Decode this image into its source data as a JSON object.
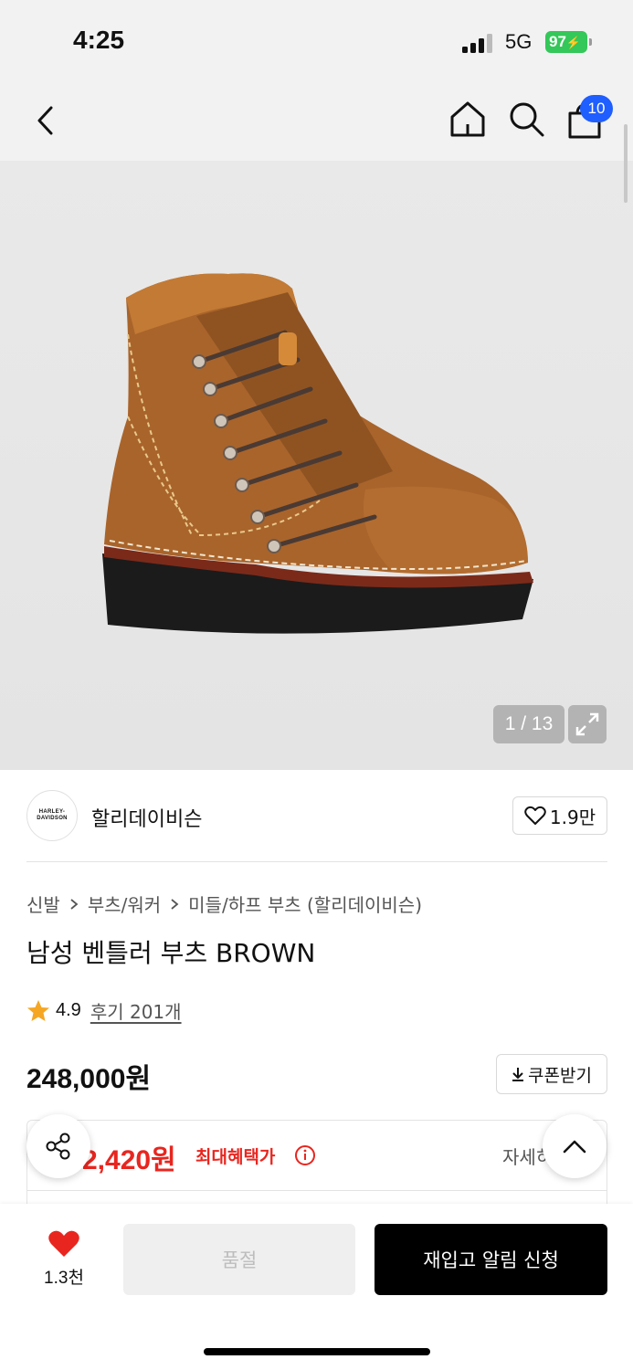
{
  "status_bar": {
    "time": "4:25",
    "network": "5G",
    "battery": "97"
  },
  "nav": {
    "cart_count": "10"
  },
  "gallery": {
    "page_counter": "1 / 13"
  },
  "brand": {
    "logo_line1": "HARLEY-",
    "logo_line2": "DAVIDSON",
    "name": "할리데이비슨",
    "like_count": "1.9만"
  },
  "breadcrumb": [
    "신발",
    "부츠/워커",
    "미들/하프 부츠 (할리데이비슨)"
  ],
  "product": {
    "title": "남성 벤틀러 부츠 BROWN",
    "rating": "4.9",
    "review_link": "후기 201개",
    "price": "248,000원",
    "coupon_label": "쿠폰받기"
  },
  "benefit": {
    "price": "2,420원",
    "label": "최대혜택가",
    "detail_link": "자세히"
  },
  "bottom_bar": {
    "wish_count": "1.3천",
    "soldout_label": "품절",
    "restock_label": "재입고 알림 신청"
  },
  "colors": {
    "accent_red": "#e8261f",
    "badge_blue": "#1f5eff",
    "battery_green": "#34c759"
  }
}
